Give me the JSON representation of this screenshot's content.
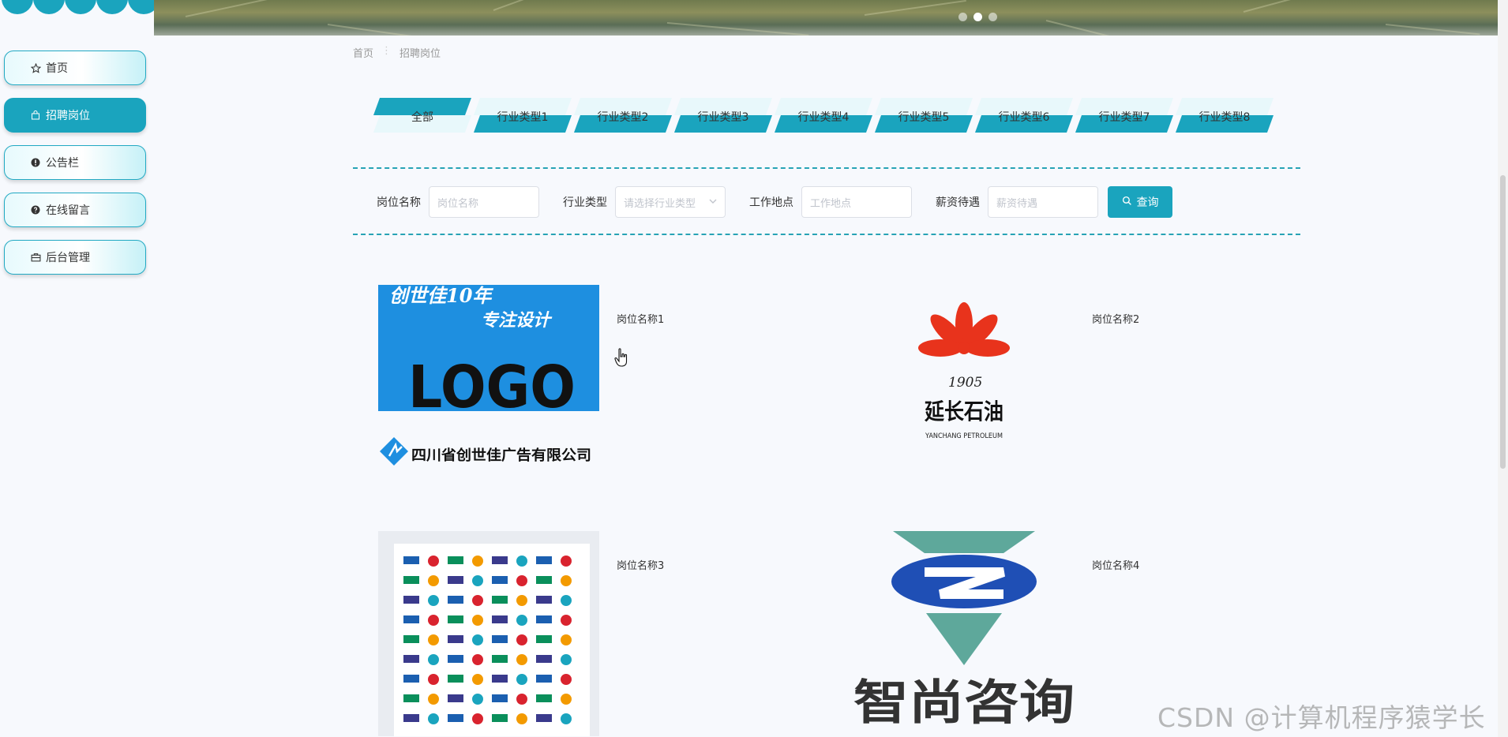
{
  "sidebar": {
    "items": [
      {
        "label": "首页",
        "icon": "star-icon",
        "active": false
      },
      {
        "label": "招聘岗位",
        "icon": "bag-icon",
        "active": true
      },
      {
        "label": "公告栏",
        "icon": "alert-icon",
        "active": false
      },
      {
        "label": "在线留言",
        "icon": "question-icon",
        "active": false
      },
      {
        "label": "后台管理",
        "icon": "briefcase-icon",
        "active": false
      }
    ]
  },
  "colors": {
    "accent": "#1aa4be",
    "background": "#f7f9fd",
    "dashed_border": "#27a3b5"
  },
  "breadcrumb": {
    "home": "首页",
    "current": "招聘岗位"
  },
  "tabs": [
    "全部",
    "行业类型1",
    "行业类型2",
    "行业类型3",
    "行业类型4",
    "行业类型5",
    "行业类型6",
    "行业类型7",
    "行业类型8"
  ],
  "search": {
    "job_name_label": "岗位名称",
    "job_name_placeholder": "岗位名称",
    "industry_label": "行业类型",
    "industry_placeholder": "请选择行业类型",
    "location_label": "工作地点",
    "location_placeholder": "工作地点",
    "salary_label": "薪资待遇",
    "salary_placeholder": "薪资待遇",
    "button_label": "查询"
  },
  "jobs": [
    {
      "title": "岗位名称1",
      "logo_texts": [
        "创世佳10年",
        "专注设计",
        "LOGO",
        "四川省创世佳广告有限公司"
      ]
    },
    {
      "title": "岗位名称2",
      "logo_texts": [
        "1905",
        "延长石油",
        "YANCHANG PETROLEUM"
      ]
    },
    {
      "title": "岗位名称3",
      "logo_texts": []
    },
    {
      "title": "岗位名称4",
      "logo_texts": [
        "智尚咨询"
      ]
    }
  ],
  "watermark": "CSDN @计算机程序猿学长"
}
